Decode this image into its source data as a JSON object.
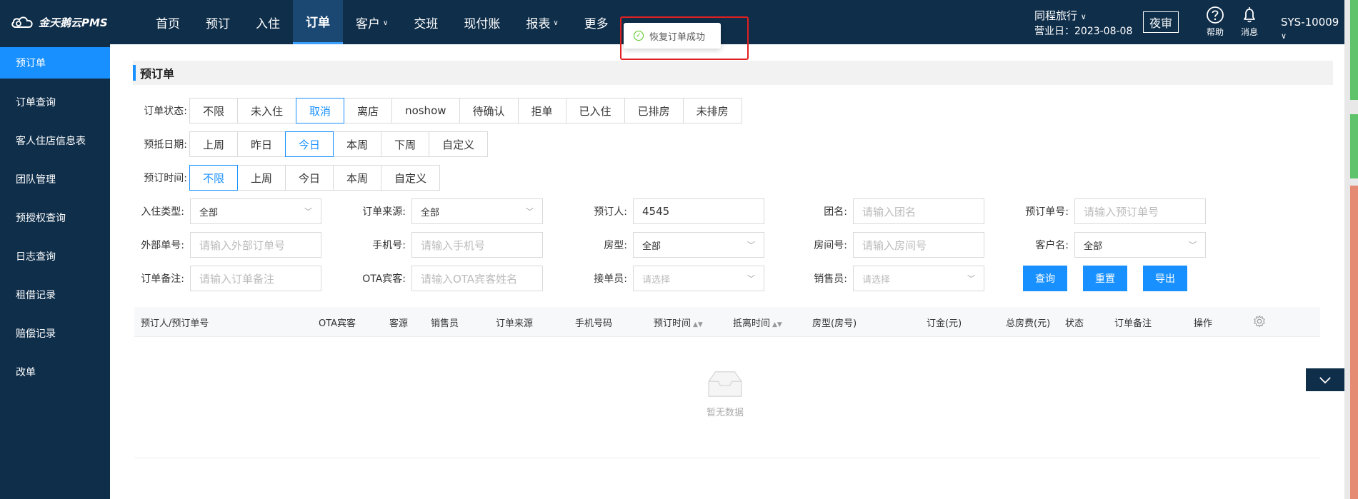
{
  "app": {
    "logo_text": "金天鹅云PMS"
  },
  "nav": {
    "items": [
      {
        "label": "首页",
        "active": false,
        "dropdown": false
      },
      {
        "label": "预订",
        "active": false,
        "dropdown": false
      },
      {
        "label": "入住",
        "active": false,
        "dropdown": false
      },
      {
        "label": "订单",
        "active": true,
        "dropdown": false
      },
      {
        "label": "客户",
        "active": false,
        "dropdown": true
      },
      {
        "label": "交班",
        "active": false,
        "dropdown": false
      },
      {
        "label": "现付账",
        "active": false,
        "dropdown": false
      },
      {
        "label": "报表",
        "active": false,
        "dropdown": true
      },
      {
        "label": "更多",
        "active": false,
        "dropdown": false
      }
    ],
    "chevron_glyph": "∨"
  },
  "toast": {
    "message": "恢复订单成功"
  },
  "header": {
    "hotel_name": "同程旅行",
    "hotel_chevron": "∨",
    "business_date": "营业日：2023-08-08",
    "night_audit": "夜审",
    "help": "帮助",
    "messages": "消息",
    "user": "SYS-10009",
    "user_chevron": "∨"
  },
  "sidebar": {
    "items": [
      {
        "label": "预订单",
        "active": true
      },
      {
        "label": "订单查询",
        "active": false
      },
      {
        "label": "客人住店信息表",
        "active": false
      },
      {
        "label": "团队管理",
        "active": false
      },
      {
        "label": "预授权查询",
        "active": false
      },
      {
        "label": "日志查询",
        "active": false
      },
      {
        "label": "租借记录",
        "active": false
      },
      {
        "label": "赔偿记录",
        "active": false
      },
      {
        "label": "改单",
        "active": false
      }
    ]
  },
  "page": {
    "title": "预订单"
  },
  "filters": {
    "order_status": {
      "label": "订单状态:",
      "options": [
        "不限",
        "未入住",
        "取消",
        "离店",
        "noshow",
        "待确认",
        "拒单",
        "已入住",
        "已排房",
        "未排房"
      ],
      "selected": 2
    },
    "arrival_date": {
      "label": "预抵日期:",
      "options": [
        "上周",
        "昨日",
        "今日",
        "本周",
        "下周",
        "自定义"
      ],
      "selected": 2
    },
    "booking_time": {
      "label": "预订时间:",
      "options": [
        "不限",
        "上周",
        "今日",
        "本周",
        "自定义"
      ],
      "selected": 0
    }
  },
  "fields": {
    "checkin_type": {
      "label": "入住类型:",
      "value": "全部"
    },
    "order_source": {
      "label": "订单来源:",
      "value": "全部"
    },
    "booker": {
      "label": "预订人:",
      "value": "4545"
    },
    "group_name": {
      "label": "团名:",
      "placeholder": "请输入团名"
    },
    "booking_no": {
      "label": "预订单号:",
      "placeholder": "请输入预订单号"
    },
    "external_no": {
      "label": "外部单号:",
      "placeholder": "请输入外部订单号"
    },
    "phone": {
      "label": "手机号:",
      "placeholder": "请输入手机号"
    },
    "room_type": {
      "label": "房型:",
      "value": "全部"
    },
    "room_no": {
      "label": "房间号:",
      "placeholder": "请输入房间号"
    },
    "customer": {
      "label": "客户名:",
      "value": "全部"
    },
    "order_note": {
      "label": "订单备注:",
      "placeholder": "请输入订单备注"
    },
    "ota_guest": {
      "label": "OTA宾客:",
      "placeholder": "请输入OTA宾客姓名"
    },
    "receptionist": {
      "label": "接单员:",
      "placeholder": "请选择"
    },
    "salesperson": {
      "label": "销售员:",
      "placeholder": "请选择"
    }
  },
  "actions": {
    "query": "查询",
    "reset": "重置",
    "export": "导出"
  },
  "table": {
    "columns": [
      "预订人/预订单号",
      "OTA宾客",
      "客源",
      "销售员",
      "订单来源",
      "手机号码",
      "预订时间",
      "抵离时间",
      "房型(房号)",
      "订金(元)",
      "总房费(元)",
      "状态",
      "订单备注",
      "操作"
    ],
    "sort_glyph": "▲▼",
    "empty_text": "暂无数据"
  }
}
